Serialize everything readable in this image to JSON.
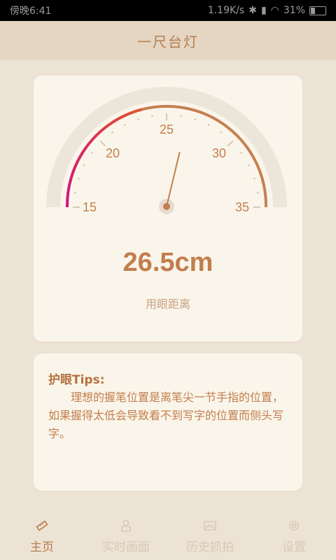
{
  "status_bar": {
    "time": "傍晚6:41",
    "speed": "1.19K/s",
    "battery": "31%"
  },
  "app": {
    "title": "一尺台灯"
  },
  "gauge": {
    "min": 15,
    "max": 35,
    "value": 26.5,
    "tick_labels": [
      "15",
      "20",
      "25",
      "30",
      "35"
    ],
    "reading": "26.5cm",
    "reading_label": "用眼距离",
    "colors": {
      "arc_brown": "#c58052",
      "arc_pink": "#d2137f",
      "needle": "#c27e4e"
    }
  },
  "tips": {
    "title": "护眼Tips:",
    "body": "理想的握笔位置是离笔尖一节手指的位置，如果握得太低会导致看不到写字的位置而侧头写字。"
  },
  "nav": {
    "items": [
      {
        "label": "主页",
        "icon": "ruler-icon",
        "active": true
      },
      {
        "label": "实时画面",
        "icon": "person-icon",
        "active": false
      },
      {
        "label": "历史抓拍",
        "icon": "image-icon",
        "active": false
      },
      {
        "label": "设置",
        "icon": "gear-icon",
        "active": false
      }
    ]
  }
}
